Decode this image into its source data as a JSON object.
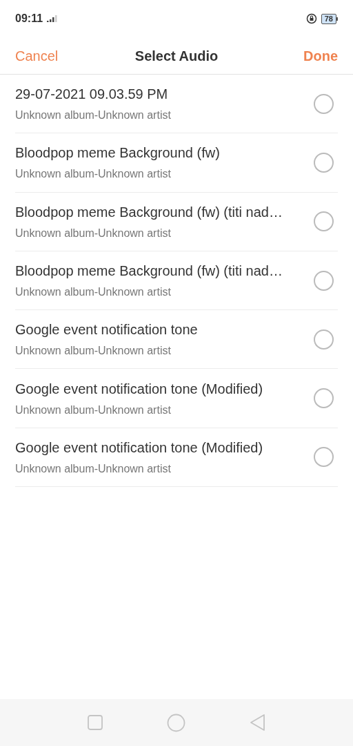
{
  "status_bar": {
    "time": "09:11",
    "battery": "78"
  },
  "header": {
    "cancel": "Cancel",
    "title": "Select Audio",
    "done": "Done"
  },
  "tracks": [
    {
      "title": "29-07-2021 09.03.59 PM",
      "subtitle": "Unknown album-Unknown artist",
      "selected": false
    },
    {
      "title": "Bloodpop meme Background (fw)",
      "subtitle": "Unknown album-Unknown artist",
      "selected": false
    },
    {
      "title": "Bloodpop meme Background (fw) (titi nad…",
      "subtitle": "Unknown album-Unknown artist",
      "selected": false
    },
    {
      "title": "Bloodpop meme Background (fw) (titi nad…",
      "subtitle": "Unknown album-Unknown artist",
      "selected": false
    },
    {
      "title": "Google event notification tone",
      "subtitle": "Unknown album-Unknown artist",
      "selected": false
    },
    {
      "title": "Google event notification tone (Modified)",
      "subtitle": "Unknown album-Unknown artist",
      "selected": false
    },
    {
      "title": "Google event notification tone (Modified)",
      "subtitle": "Unknown album-Unknown artist",
      "selected": false
    }
  ]
}
